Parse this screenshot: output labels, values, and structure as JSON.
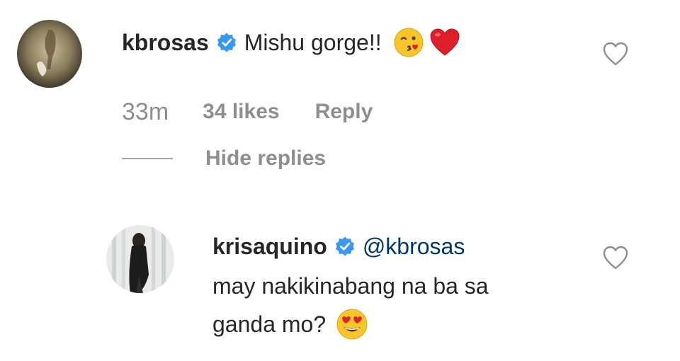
{
  "comments": [
    {
      "username": "kbrosas",
      "text": "Mishu gorge!!",
      "emojis": [
        "kissing-wink-emoji",
        "red-heart-emoji"
      ],
      "time": "33m",
      "likes": "34 likes",
      "reply_label": "Reply",
      "hide_replies_label": "Hide replies"
    }
  ],
  "replies": [
    {
      "username": "krisaquino",
      "mention": "@kbrosas",
      "text_line1": "may nakikinabang na ba sa",
      "text_line2": "ganda mo?",
      "emojis": [
        "heart-eyes-emoji"
      ]
    }
  ],
  "colors": {
    "text": "#262626",
    "meta": "#8e8e8e",
    "verified": "#3897f0",
    "mention": "#00376b",
    "heart_outline": "#8e8e8e"
  },
  "icons": {
    "verified": "verified-badge-icon",
    "like": "heart-outline-icon"
  }
}
